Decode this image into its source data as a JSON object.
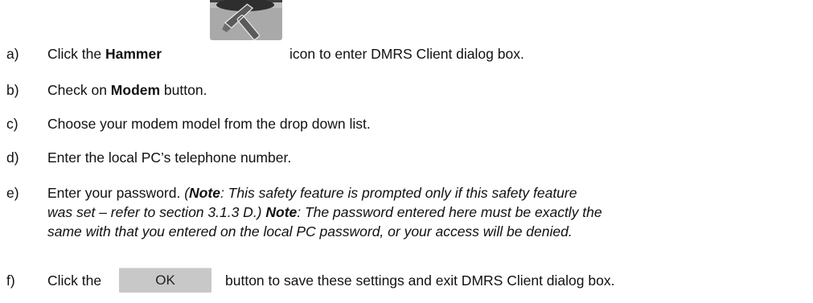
{
  "steps": [
    {
      "marker": "a)",
      "before": "Click the ",
      "bold": "Hammer",
      "after": "icon to enter DMRS Client dialog box.",
      "icon": "hammer-icon"
    },
    {
      "marker": "b)",
      "before": "Check on ",
      "bold": "Modem",
      "after": " button."
    },
    {
      "marker": "c)",
      "text": "Choose your modem model from the drop down list."
    },
    {
      "marker": "d)",
      "text": "Enter the local PC’s telephone number."
    },
    {
      "marker": "e)",
      "before": "Enter your password. ",
      "note_open": "(",
      "note_label": "Note",
      "note_text": ": This safety feature is prompted only if this safety feature",
      "line2": "was set – refer to section 3.1.3 D.) ",
      "note2_label": "Note",
      "line2_rest": ": The password entered here must be exactly the",
      "line3": "same with that you entered on the local PC password, or your access will be denied."
    },
    {
      "marker": "f)",
      "before": "Click the",
      "button_label": "OK",
      "after": "button to save these settings and exit DMRS Client dialog box."
    }
  ]
}
